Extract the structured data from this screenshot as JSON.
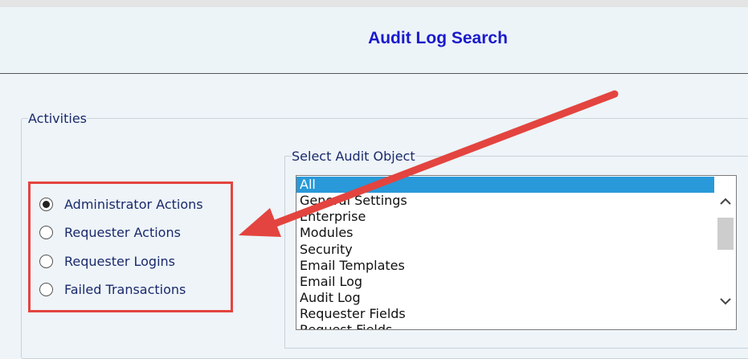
{
  "header": {
    "title": "Audit Log Search"
  },
  "activities": {
    "legend": "Activities",
    "options": [
      {
        "label": "Administrator Actions",
        "checked": true
      },
      {
        "label": "Requester Actions",
        "checked": false
      },
      {
        "label": "Requester Logins",
        "checked": false
      },
      {
        "label": "Failed Transactions",
        "checked": false
      }
    ]
  },
  "audit_object": {
    "legend": "Select Audit Object",
    "selected": "All",
    "items": [
      "All",
      "General Settings",
      "Enterprise",
      "Modules",
      "Security",
      "Email Templates",
      "Email Log",
      "Audit Log",
      "Requester Fields",
      "Request Fields"
    ]
  },
  "colors": {
    "highlight_box": "#e3443f",
    "selection": "#2999d9",
    "title": "#1a1acc",
    "text": "#1a2a6c"
  },
  "icons": [
    "chevron-up-icon",
    "chevron-down-icon",
    "annotation-arrow"
  ]
}
